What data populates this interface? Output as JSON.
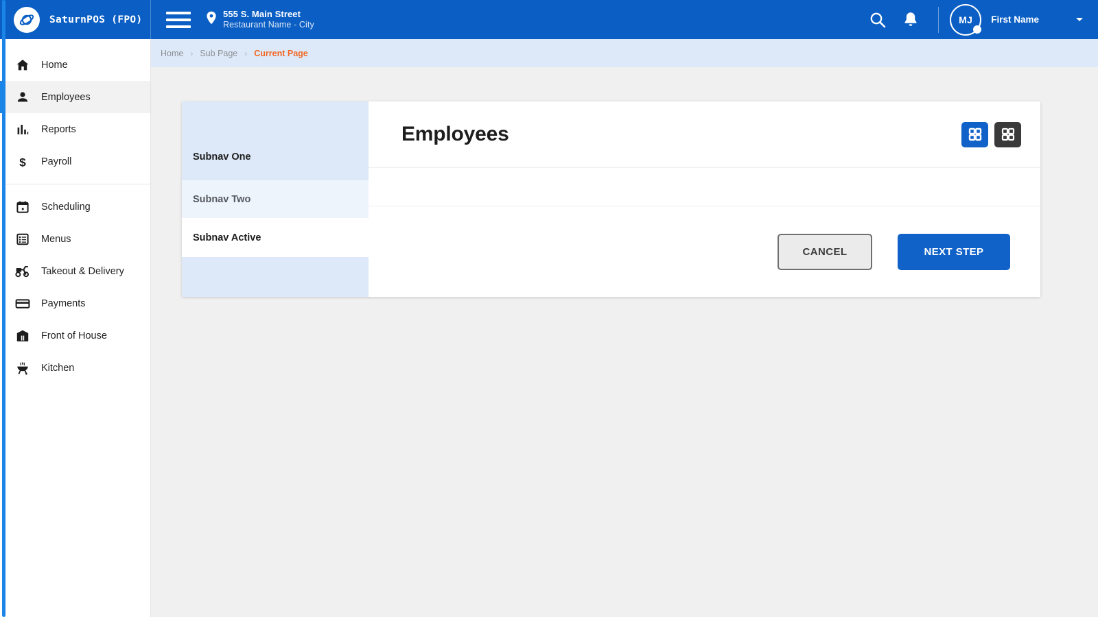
{
  "brand": {
    "name": "SaturnPOS (FPO)",
    "logo_icon": "saturn-planet-icon"
  },
  "topbar": {
    "menu_icon": "hamburger-menu-icon",
    "location": {
      "pin_icon": "map-pin-icon",
      "address": "555 S. Main Street",
      "restaurant": "Restaurant Name - City"
    },
    "search_icon": "search-icon",
    "notifications_icon": "bell-icon",
    "user": {
      "initials": "MJ",
      "name": "First Name",
      "caret_icon": "chevron-down-icon"
    },
    "background_color": "#0b5fc4"
  },
  "sidebar": {
    "items": [
      {
        "label": "Home",
        "icon": "home-icon",
        "active": false
      },
      {
        "label": "Employees",
        "icon": "person-icon",
        "active": true
      },
      {
        "label": "Reports",
        "icon": "bar-chart-icon",
        "active": false
      },
      {
        "label": "Payroll",
        "icon": "dollar-sign-icon",
        "active": false
      },
      {
        "label": "Scheduling",
        "icon": "calendar-icon",
        "active": false
      },
      {
        "label": "Menus",
        "icon": "list-icon",
        "active": false
      },
      {
        "label": "Takeout & Delivery",
        "icon": "delivery-scooter-icon",
        "active": false
      },
      {
        "label": "Payments",
        "icon": "credit-card-icon",
        "active": false
      },
      {
        "label": "Front of House",
        "icon": "storefront-icon",
        "active": false
      },
      {
        "label": "Kitchen",
        "icon": "grill-icon",
        "active": false
      }
    ],
    "active_accent_color": "#1b84e7"
  },
  "breadcrumb": {
    "items": [
      {
        "label": "Home",
        "current": false
      },
      {
        "label": "Sub Page",
        "current": false
      },
      {
        "label": "Current Page",
        "current": true
      }
    ],
    "separator": "›",
    "current_color": "#f26722"
  },
  "card": {
    "subnav": [
      {
        "label": "Subnav One",
        "state": "default"
      },
      {
        "label": "Subnav Two",
        "state": "hover"
      },
      {
        "label": "Subnav Active",
        "state": "active"
      }
    ],
    "panel": {
      "title": "Employees",
      "view_toggle": [
        {
          "icon": "grid-view-icon",
          "selected": true
        },
        {
          "icon": "grid-view-detail-icon",
          "selected": false
        }
      ],
      "actions": {
        "cancel_label": "CANCEL",
        "next_label": "NEXT STEP"
      }
    }
  },
  "colors": {
    "brand_blue": "#0b5fc4",
    "accent_blue": "#1b84e7",
    "button_blue": "#1062c9",
    "orange": "#f26722",
    "page_background": "#f0f0f0",
    "breadcrumb_background": "#dde9f8"
  }
}
